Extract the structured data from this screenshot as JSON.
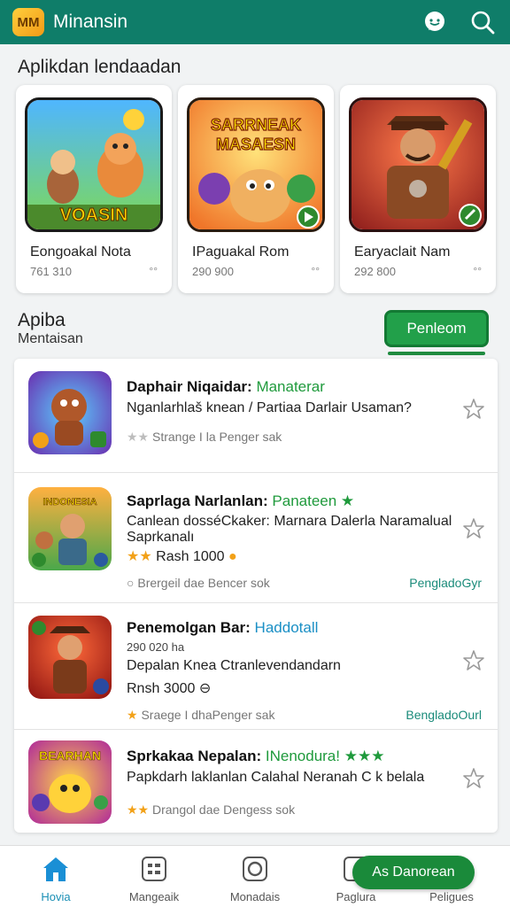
{
  "header": {
    "logo_text": "MM",
    "title": "Minansin"
  },
  "featured": {
    "title": "Aplikdan lendaadan",
    "items": [
      {
        "name": "Eongoakal Nota",
        "meta": "761 310",
        "more": "°°",
        "art_text": "VOASIN"
      },
      {
        "name": "IPaguakal Rom",
        "meta": "290 900",
        "more": "°°",
        "art_text": "SARRNEAK MASAESN"
      },
      {
        "name": "Earyaclait Nam",
        "meta": "292 800",
        "more": "°°",
        "art_text": ""
      }
    ]
  },
  "section2": {
    "title": "Apiba",
    "subtitle": "Mentaisan",
    "button_label": "Penleom"
  },
  "list": [
    {
      "title": "Daphair Niqaidar:",
      "tag": "Manaterar",
      "desc": "Nganlarhlaš knean / Partiaa Darlair Usaman?",
      "desc2": "",
      "price": "",
      "stars_text": "Strange I la Penger sak",
      "stars": "★★",
      "stars_style": "grey",
      "link": ""
    },
    {
      "title": "Saprlaga Narlanlan:",
      "tag": "Panateen ★",
      "desc": "Canlean dosséCkaker: Marnara Dalerla Naramalual",
      "desc2": "Saprkanalı",
      "price": "Rash 1000",
      "stars_text": "Brergeil dae Bencer sok",
      "stars": "○",
      "stars_style": "grey",
      "link": "PengladoGyr"
    },
    {
      "title": "Penemolgan Bar:",
      "tag": "Haddotall",
      "desc": "Depalan Knea Ctranlevendandarn",
      "desc2": "290 020 ha",
      "price": "Rnsh 3000 ⊖",
      "stars_text": "Sraege I dhaPenger sak",
      "stars": "★",
      "stars_style": "gold",
      "link": "BengladoOurl"
    },
    {
      "title": "Sprkakaa Nepalan:",
      "tag": "INenodura! ★★★",
      "desc": "Papkdarh laklanlan Calahal Neranah C k belala",
      "desc2": "",
      "price": "",
      "stars_text": "Drangol dae Dengess sok",
      "stars": "★★",
      "stars_style": "gold",
      "link": ""
    }
  ],
  "nav": [
    {
      "label": "Hovia",
      "icon": "home-icon"
    },
    {
      "label": "Mangeaik",
      "icon": "grid-icon"
    },
    {
      "label": "Monadais",
      "icon": "circle-icon"
    },
    {
      "label": "Paglura",
      "icon": "box-icon"
    },
    {
      "label": "Peligues",
      "icon": "more-icon"
    }
  ],
  "fab_label": "As Danorean",
  "colors": {
    "header_bg": "#0f7d69",
    "accent_green": "#22a04a",
    "link_teal": "#1a8b7a",
    "star_gold": "#f2a118"
  }
}
